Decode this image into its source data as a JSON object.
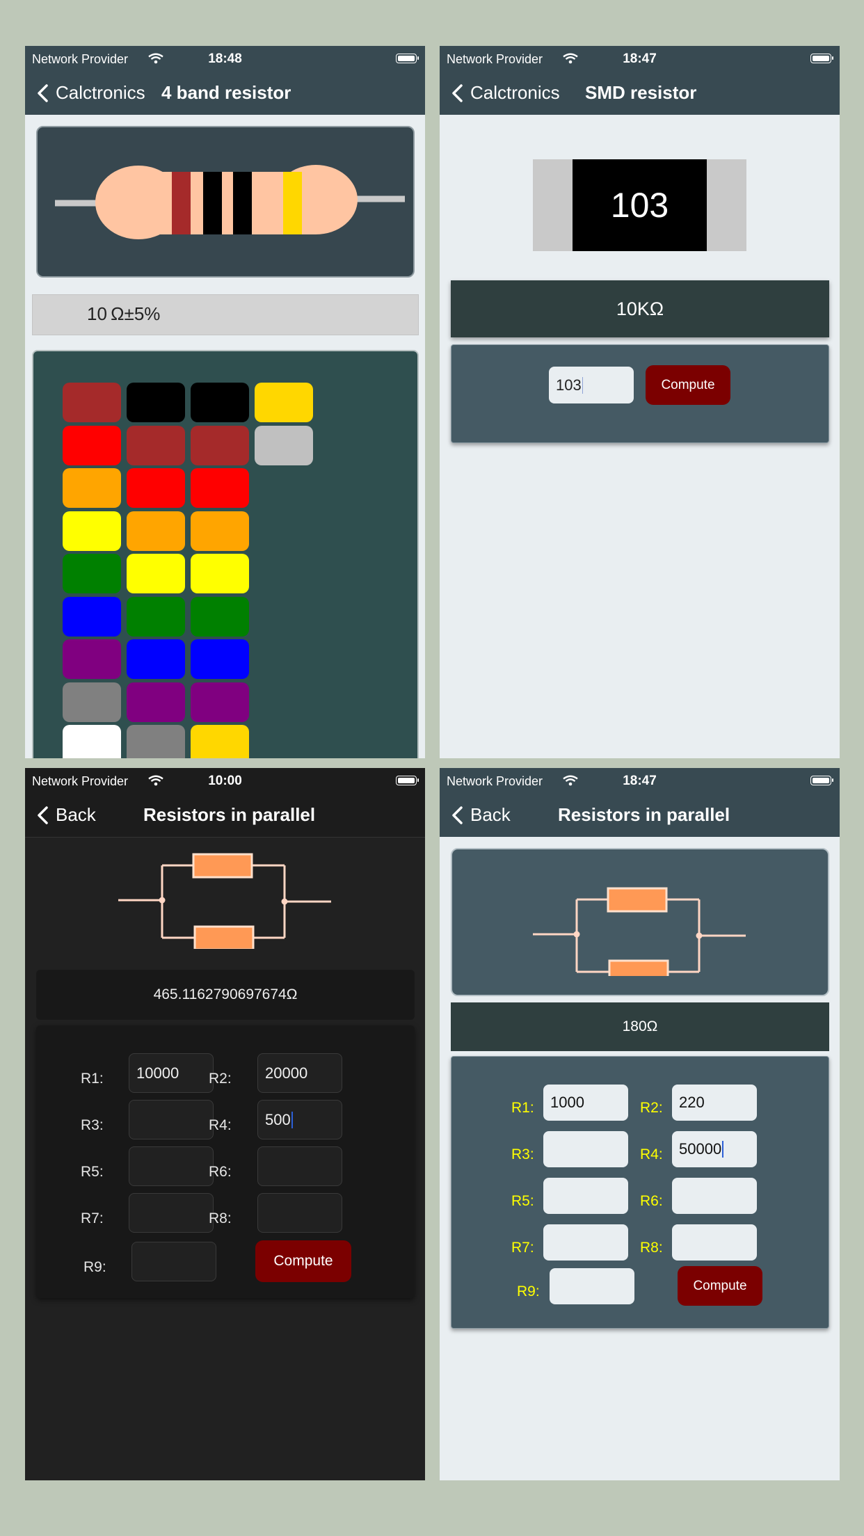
{
  "screens": {
    "band": {
      "status": {
        "provider": "Network Provider",
        "time": "18:48"
      },
      "nav": {
        "back": "Calctronics",
        "title": "4 band resistor"
      },
      "result": "10 Ω±5%",
      "bands": [
        "#a52a2a",
        "#000000",
        "#000000",
        "#ffd700"
      ],
      "palette_columns": [
        [
          "#a52a2a",
          "#ff0000",
          "#ffa500",
          "#ffff00",
          "#008000",
          "#0000ff",
          "#800080",
          "#808080",
          "#ffffff"
        ],
        [
          "#000000",
          "#a52a2a",
          "#ff0000",
          "#ffa500",
          "#ffff00",
          "#008000",
          "#0000ff",
          "#800080",
          "#808080"
        ],
        [
          "#000000",
          "#a52a2a",
          "#ff0000",
          "#ffa500",
          "#ffff00",
          "#008000",
          "#0000ff",
          "#800080",
          "#ffd700"
        ],
        [
          "#ffd700",
          "#c0c0c0"
        ]
      ]
    },
    "smd": {
      "status": {
        "provider": "Network Provider",
        "time": "18:47"
      },
      "nav": {
        "back": "Calctronics",
        "title": "SMD resistor"
      },
      "chip_code": "103",
      "result": "10KΩ",
      "input_value": "103",
      "compute_label": "Compute"
    },
    "parallel_dark": {
      "status": {
        "provider": "Network Provider",
        "time": "10:00"
      },
      "nav": {
        "back": "Back",
        "title": "Resistors in parallel"
      },
      "result": "465.1162790697674Ω",
      "labels": [
        "R1:",
        "R2:",
        "R3:",
        "R4:",
        "R5:",
        "R6:",
        "R7:",
        "R8:",
        "R9:"
      ],
      "values": [
        "10000",
        "20000",
        "",
        "500",
        "",
        "",
        "",
        "",
        ""
      ],
      "compute_label": "Compute"
    },
    "parallel_light": {
      "status": {
        "provider": "Network Provider",
        "time": "18:47"
      },
      "nav": {
        "back": "Back",
        "title": "Resistors in parallel"
      },
      "result": "180Ω",
      "labels": [
        "R1:",
        "R2:",
        "R3:",
        "R4:",
        "R5:",
        "R6:",
        "R7:",
        "R8:",
        "R9:"
      ],
      "values": [
        "1000",
        "220",
        "",
        "50000",
        "",
        "",
        "",
        "",
        ""
      ],
      "compute_label": "Compute"
    }
  }
}
